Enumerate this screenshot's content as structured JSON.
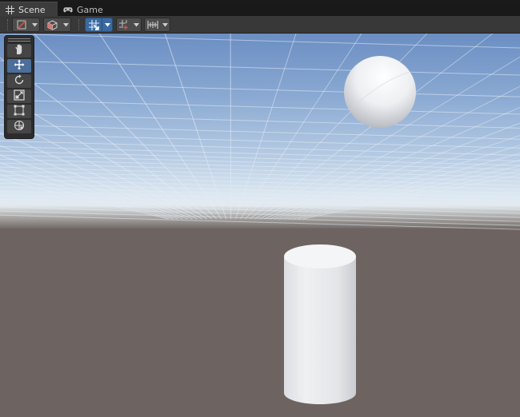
{
  "tabs": [
    {
      "label": "Scene",
      "icon": "grid-icon",
      "active": true
    },
    {
      "label": "Game",
      "icon": "gamepad-icon",
      "active": false
    }
  ],
  "toolbar": {
    "items": [
      {
        "name": "draw-mode-dropdown",
        "icon": "draw-mode-icon"
      },
      {
        "name": "render-mode-dropdown",
        "icon": "cube-icon"
      },
      {
        "name": "grid-snap-toggle",
        "icon": "grid-snap-icon",
        "active": true
      },
      {
        "name": "gizmo-snap-dropdown",
        "icon": "increment-snap-icon"
      },
      {
        "name": "view-options-dropdown",
        "icon": "ruler-icon"
      }
    ]
  },
  "tools": [
    {
      "name": "hand-tool",
      "icon": "hand-icon",
      "active": false
    },
    {
      "name": "move-tool",
      "icon": "move-icon",
      "active": true
    },
    {
      "name": "rotate-tool",
      "icon": "rotate-icon",
      "active": false
    },
    {
      "name": "scale-tool",
      "icon": "scale-icon",
      "active": false
    },
    {
      "name": "rect-tool",
      "icon": "rect-icon",
      "active": false
    },
    {
      "name": "transform-tool",
      "icon": "transform-icon",
      "active": false
    }
  ],
  "scene": {
    "objects": [
      "sphere",
      "cylinder"
    ],
    "colors": {
      "sky_top": "#6d8fc2",
      "horizon": "#dfe9f2",
      "ground": "#6d6461",
      "object": "#e8eaed"
    }
  }
}
